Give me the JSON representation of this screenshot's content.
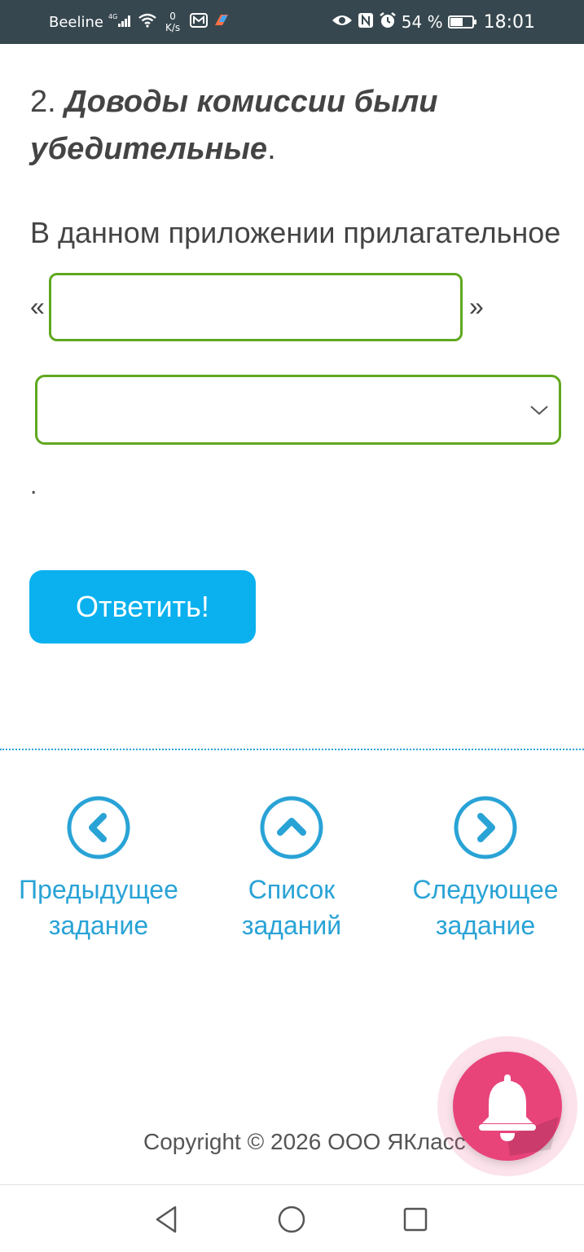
{
  "status_bar": {
    "carrier": "Beeline",
    "network": "4G",
    "speed_value": "0",
    "speed_unit": "K/s",
    "battery": "54 %",
    "time": "18:01",
    "battery_level": 0.54
  },
  "question": {
    "number": "2.",
    "text": "Доводы комиссии были убедительные",
    "end": "."
  },
  "prompt": "В данном приложении прилагательное",
  "quote_open": "«",
  "quote_close": "»",
  "answer_input": {
    "value": "",
    "placeholder": ""
  },
  "answer_select": {
    "selected": ""
  },
  "trailing_dot": ".",
  "submit_label": "Ответить!",
  "nav": {
    "prev_line1": "Предыдущее",
    "prev_line2": "задание",
    "list_line1": "Список",
    "list_line2": "заданий",
    "next_line1": "Следующее",
    "next_line2": "задание"
  },
  "copyright": "Copyright © 2026 ООО ЯКласс",
  "colors": {
    "accent": "#29a3d6",
    "button": "#0ab1ee",
    "input_border": "#5fa81f",
    "bell": "#e8447a"
  }
}
